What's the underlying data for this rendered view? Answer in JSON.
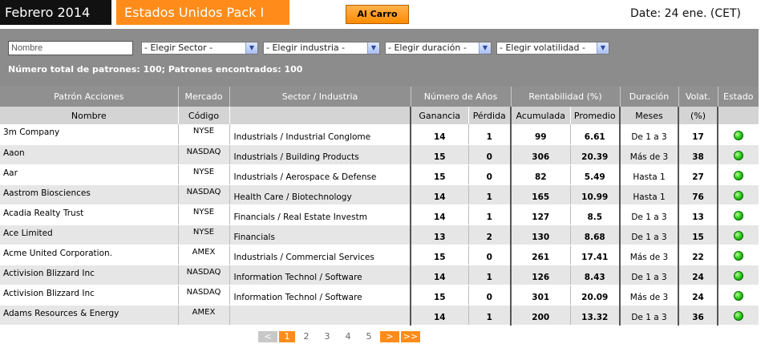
{
  "header": {
    "period": "Febrero 2014",
    "pack": "Estados Unidos Pack I",
    "cart_label": "Al Carro",
    "date": "Date: 24 ene. (CET)"
  },
  "filters": {
    "name_placeholder": "Nombre",
    "sector": "- Elegir Sector -",
    "industry": "- Elegir industria -",
    "duration": "- Elegir duración -",
    "volatility": "- Elegir volatilidad -",
    "counts": "Número total de patrones: 100;  Patrones encontrados: 100"
  },
  "table": {
    "group_headers": {
      "patron": "Patrón Acciones",
      "mercado": "Mercado",
      "sector": "Sector / Industria",
      "anios": "Número de Años",
      "rent": "Rentabilidad (%)",
      "duracion": "Duración",
      "volat": "Volat.",
      "estado": "Estado"
    },
    "sub_headers": {
      "nombre": "Nombre",
      "codigo": "Código",
      "ganancia": "Ganancia",
      "perdida": "Pérdida",
      "acumulada": "Acumulada",
      "promedio": "Promedio",
      "meses": "Meses",
      "pct": "(%)"
    },
    "rows": [
      {
        "name": "3m Company",
        "market": "NYSE",
        "sector": "Industrials / Industrial Conglome",
        "gain": "14",
        "loss": "1",
        "acc": "99",
        "avg": "6.61",
        "dur": "De 1 a 3",
        "vol": "17"
      },
      {
        "name": "Aaon",
        "market": "NASDAQ",
        "sector": "Industrials / Building Products",
        "gain": "15",
        "loss": "0",
        "acc": "306",
        "avg": "20.39",
        "dur": "Más de 3",
        "vol": "38"
      },
      {
        "name": "Aar",
        "market": "NYSE",
        "sector": "Industrials / Aerospace & Defense",
        "gain": "15",
        "loss": "0",
        "acc": "82",
        "avg": "5.49",
        "dur": "Hasta 1",
        "vol": "27"
      },
      {
        "name": "Aastrom Biosciences",
        "market": "NASDAQ",
        "sector": "Health Care / Biotechnology",
        "gain": "14",
        "loss": "1",
        "acc": "165",
        "avg": "10.99",
        "dur": "Hasta 1",
        "vol": "76"
      },
      {
        "name": "Acadia Realty Trust",
        "market": "NYSE",
        "sector": "Financials / Real Estate Investm",
        "gain": "14",
        "loss": "1",
        "acc": "127",
        "avg": "8.5",
        "dur": "De 1 a 3",
        "vol": "13"
      },
      {
        "name": "Ace Limited",
        "market": "NYSE",
        "sector": "Financials",
        "gain": "13",
        "loss": "2",
        "acc": "130",
        "avg": "8.68",
        "dur": "De 1 a 3",
        "vol": "15"
      },
      {
        "name": "Acme United Corporation.",
        "market": "AMEX",
        "sector": "Industrials / Commercial Services",
        "gain": "15",
        "loss": "0",
        "acc": "261",
        "avg": "17.41",
        "dur": "Más de 3",
        "vol": "22"
      },
      {
        "name": "Activision Blizzard Inc",
        "market": "NASDAQ",
        "sector": "Information Technol / Software",
        "gain": "14",
        "loss": "1",
        "acc": "126",
        "avg": "8.43",
        "dur": "De 1 a 3",
        "vol": "24"
      },
      {
        "name": "Activision Blizzard Inc",
        "market": "NASDAQ",
        "sector": "Information Technol / Software",
        "gain": "15",
        "loss": "0",
        "acc": "301",
        "avg": "20.09",
        "dur": "Más de 3",
        "vol": "24"
      },
      {
        "name": "Adams Resources & Energy",
        "market": "AMEX",
        "sector": "",
        "gain": "14",
        "loss": "1",
        "acc": "200",
        "avg": "13.32",
        "dur": "De 1 a 3",
        "vol": "36"
      }
    ],
    "status_icon": "green-status-dot-icon"
  },
  "pager": {
    "prev": "<",
    "pages": [
      "1",
      "2",
      "3",
      "4",
      "5"
    ],
    "current": "1",
    "next": ">",
    "last": ">>"
  }
}
